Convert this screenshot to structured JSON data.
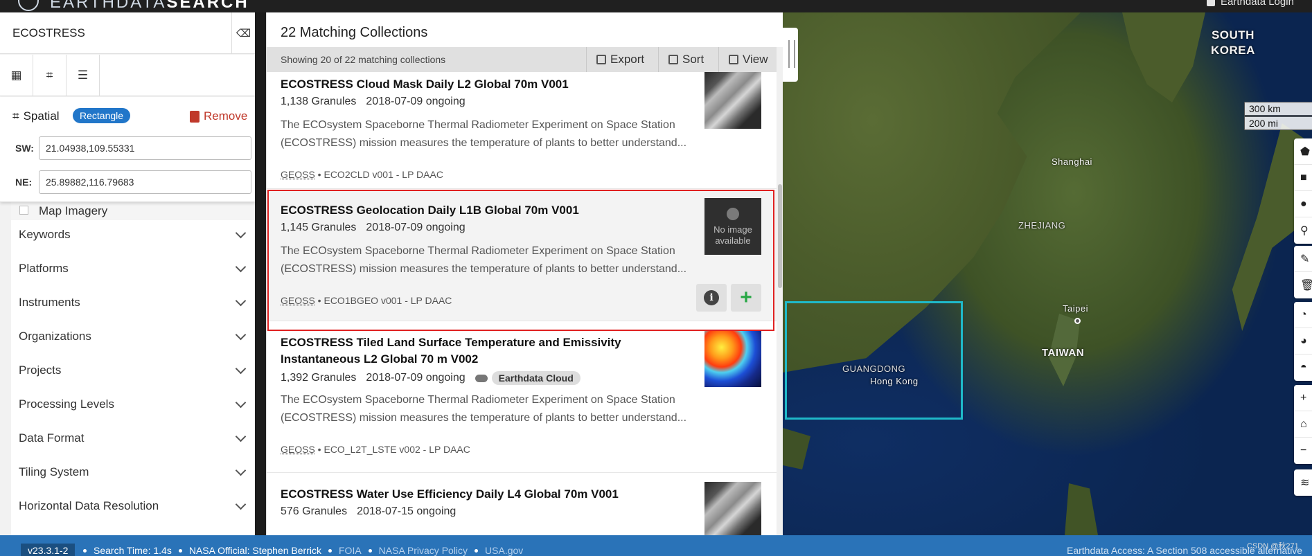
{
  "header": {
    "logo_text_light": "EARTHDATA",
    "logo_text_bold": "SEARCH",
    "login_label": "Earthdata Login"
  },
  "sidebar": {
    "search_value": "ECOSTRESS",
    "spatial": {
      "label": "Spatial",
      "type_badge": "Rectangle",
      "remove_label": "Remove",
      "sw_label": "SW:",
      "sw_value": "21.04938,109.55331",
      "ne_label": "NE:",
      "ne_value": "25.89882,116.79683"
    },
    "map_imagery_label": "Map Imagery",
    "facets": [
      "Keywords",
      "Platforms",
      "Instruments",
      "Organizations",
      "Projects",
      "Processing Levels",
      "Data Format",
      "Tiling System",
      "Horizontal Data Resolution"
    ]
  },
  "results": {
    "title": "22 Matching Collections",
    "showing": "Showing 20 of 22 matching collections",
    "export_label": "Export",
    "sort_label": "Sort",
    "view_label": "View",
    "items": [
      {
        "title": "ECOSTRESS Cloud Mask Daily L2 Global 70m V001",
        "granules": "1,138 Granules",
        "temporal": "2018-07-09 ongoing",
        "description": "The ECOsystem Spaceborne Thermal Radiometer Experiment on Space Station (ECOSTRESS) mission measures the temperature of plants to better understand...",
        "tag": "GEOSS",
        "source": " • ECO2CLD v001 - LP DAAC"
      },
      {
        "title": "ECOSTRESS Geolocation Daily L1B Global 70m V001",
        "granules": "1,145 Granules",
        "temporal": "2018-07-09 ongoing",
        "description": "The ECOsystem Spaceborne Thermal Radiometer Experiment on Space Station (ECOSTRESS) mission measures the temperature of plants to better understand...",
        "tag": "GEOSS",
        "source": " • ECO1BGEO v001 - LP DAAC",
        "no_image_text": "No image available"
      },
      {
        "title": "ECOSTRESS Tiled Land Surface Temperature and Emissivity Instantaneous L2 Global 70 m V002",
        "granules": "1,392 Granules",
        "temporal": "2018-07-09 ongoing",
        "cloud_badge": "Earthdata Cloud",
        "description": "The ECOsystem Spaceborne Thermal Radiometer Experiment on Space Station (ECOSTRESS) mission measures the temperature of plants to better understand...",
        "tag": "GEOSS",
        "source": " • ECO_L2T_LSTE v002 - LP DAAC"
      },
      {
        "title": "ECOSTRESS Water Use Efficiency Daily L4 Global 70m V001",
        "granules": "576 Granules",
        "temporal": "2018-07-15 ongoing"
      }
    ]
  },
  "map": {
    "labels": {
      "south_korea": "SOUTH\nKOREA",
      "shanghai": "Shanghai",
      "zhejiang": "ZHEJIANG",
      "taipei": "Taipei",
      "taiwan": "TAIWAN",
      "guangdong": "GUANGDONG",
      "hong_kong": "Hong Kong"
    },
    "scale_km": "300 km",
    "scale_mi": "200 mi",
    "spatial_box_color": "#1fb9c9"
  },
  "footer": {
    "version": "v23.3.1-2",
    "search_time": "Search Time: 1.4s",
    "nasa_official": "NASA Official: Stephen Berrick",
    "foia": "FOIA",
    "privacy": "NASA Privacy Policy",
    "usa_gov": "USA.gov",
    "access": "Earthdata Access: A Section 508 accessible alternative",
    "watermark": "CSDN @秋271"
  }
}
